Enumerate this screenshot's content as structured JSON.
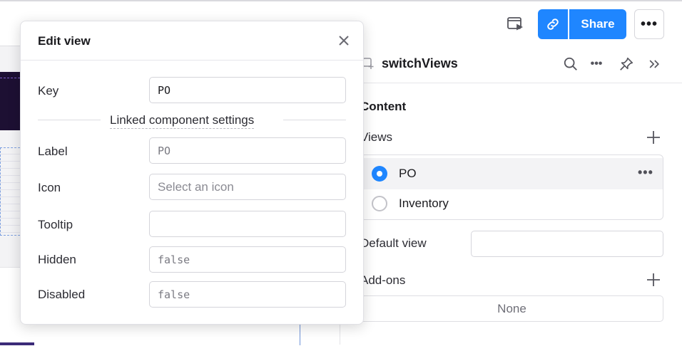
{
  "toolbar": {
    "preview_icon": "preview-icon",
    "link_icon": "link-icon",
    "share_label": "Share",
    "more_label": "•••"
  },
  "inspector": {
    "component_name": "switchViews",
    "content_title": "Content",
    "views_label": "Views",
    "views": [
      {
        "label": "PO",
        "selected": true,
        "more": "•••"
      },
      {
        "label": "Inventory",
        "selected": false
      }
    ],
    "default_view_label": "Default view",
    "default_view_value": "",
    "addons_label": "Add-ons",
    "addons_value": "None"
  },
  "modal": {
    "title": "Edit view",
    "key_label": "Key",
    "key_value": "PO",
    "section_label": "Linked component settings",
    "label_label": "Label",
    "label_value": "PO",
    "icon_label": "Icon",
    "icon_placeholder": "Select an icon",
    "tooltip_label": "Tooltip",
    "tooltip_value": "",
    "hidden_label": "Hidden",
    "hidden_value": "false",
    "disabled_label": "Disabled",
    "disabled_value": "false"
  },
  "colors": {
    "accent": "#1f86ff",
    "canvas_dark": "#1d1033"
  }
}
